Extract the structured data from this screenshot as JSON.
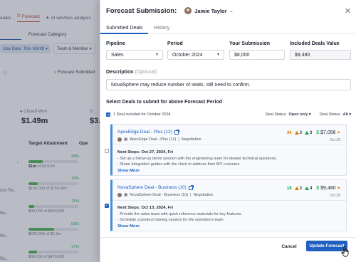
{
  "background": {
    "tabs": [
      "anies",
      "Forecast",
      "AI win/loss analysis"
    ],
    "subtab": "Forecast Category",
    "filters": [
      "lose Date: This Month",
      "Team & Member"
    ],
    "forecast_submitted": "Forecast Submitted",
    "closed_won_label": "Closed Won",
    "closed_won_value": "$1.49m",
    "g_value": "G",
    "g_value2": "$3.",
    "table_headers": [
      "Target Attainment",
      "Ope"
    ],
    "attainment": [
      {
        "pct": "28%",
        "value": "$1m",
        "of": "of $3.52m",
        "fill": 0.28
      },
      {
        "pct": "19%",
        "value": "$150,000",
        "of": "of $750,000",
        "fill": 0.19
      },
      {
        "pct": "11%",
        "value": "$90,000",
        "of": "of $800,000",
        "fill": 0.11
      },
      {
        "pct": "51%",
        "value": "$620,000",
        "of": "of $1.2m",
        "fill": 0.51
      },
      {
        "pct": "17%",
        "value": "$80,000",
        "of": "of $470,000",
        "fill": 0.17
      }
    ],
    "row_labels": [
      "nior Re...",
      "Re...",
      "Re...",
      "Re...",
      "Re..."
    ]
  },
  "drawer": {
    "title": "Forecast Submission:",
    "owner": "Jamie Taylor",
    "tabs": [
      "Submitted Deals",
      "History"
    ],
    "fields": {
      "pipeline_label": "Pipeline",
      "pipeline_value": "Sales",
      "period_label": "Period",
      "period_value": "October 2024",
      "submission_label": "Your Submission",
      "submission_value": "$8,000",
      "included_label": "Included Deals Value",
      "included_value": "$9,480"
    },
    "description_label": "Description",
    "description_optional": "(Optional)",
    "description_value": "NovaSphere may reduce number of seats, still need to confirm.",
    "section_title": "Select Deals to submit for above Forecast Period",
    "toolbar": {
      "included_text": "1 Deal included for October 2024",
      "deal_status_label_1": "Deal Status:",
      "deal_status_value_1": "Open only",
      "deal_status_label_2": "Deal Status:",
      "deal_status_value_2": "All"
    },
    "deals": [
      {
        "name": "ApexEdge Deal - Plus (12)",
        "meta_company": "ApexEdge Deal - Plus (12)",
        "meta_stage": "Negotiation",
        "score": "34",
        "warn": "3",
        "ok": "3",
        "amount": "$7,056",
        "date": "Oct 29",
        "next_steps_title": "Next Steps: Oct 27, 2024, Fri",
        "items": [
          "- Set up a follow-up demo session with the engineering team for deeper technical questions.",
          "- Share integration guides with the client to address their API concerns."
        ],
        "show_more": "Show More",
        "checked": false
      },
      {
        "name": "NovaSphere Deal - Business (10)",
        "meta_company": "NovaSphere Deal - Business (10)",
        "meta_stage": "Negotiation",
        "score": "18",
        "warn": "3",
        "ok": "4",
        "amount": "$9,480",
        "date": "Oct 29",
        "next_steps_title": "Next Steps: Oct 13, 2024, Fri",
        "items": [
          "- Provide the sales team with quick-reference materials for key features.",
          "- Schedule a product training session for the operations team."
        ],
        "show_more": "Show More",
        "checked": true
      }
    ],
    "cancel_label": "Cancel",
    "update_label": "Update Forecast"
  }
}
